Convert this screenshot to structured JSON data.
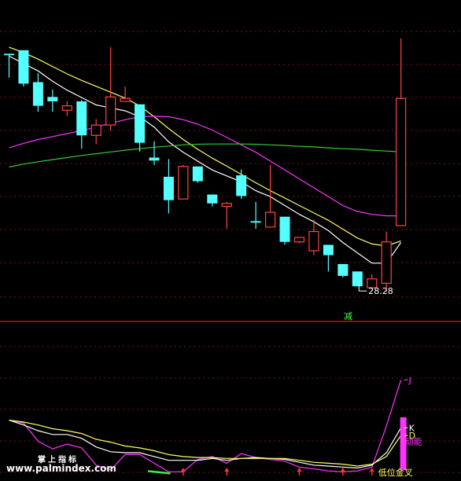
{
  "chart_data": [
    {
      "type": "candlestick",
      "panel": "main",
      "ylim": [
        27.4,
        36.7
      ],
      "candles": [
        {
          "o": 35.63,
          "h": 35.68,
          "l": 34.87,
          "c": 35.68,
          "color": "cyan"
        },
        {
          "o": 35.8,
          "h": 35.8,
          "l": 34.57,
          "c": 34.67,
          "color": "cyan"
        },
        {
          "o": 34.72,
          "h": 35.02,
          "l": 33.72,
          "c": 33.92,
          "color": "cyan"
        },
        {
          "o": 34.22,
          "h": 34.47,
          "l": 33.72,
          "c": 34.07,
          "color": "cyan"
        },
        {
          "o": 33.77,
          "h": 34.07,
          "l": 33.57,
          "c": 33.92,
          "color": "red"
        },
        {
          "o": 34.07,
          "h": 34.12,
          "l": 32.47,
          "c": 32.92,
          "color": "cyan"
        },
        {
          "o": 32.92,
          "h": 33.47,
          "l": 32.62,
          "c": 33.27,
          "color": "red"
        },
        {
          "o": 33.27,
          "h": 35.9,
          "l": 33.07,
          "c": 34.22,
          "color": "red"
        },
        {
          "o": 34.07,
          "h": 34.57,
          "l": 34.07,
          "c": 34.17,
          "color": "red"
        },
        {
          "o": 33.97,
          "h": 33.97,
          "l": 32.37,
          "c": 32.67,
          "color": "cyan"
        },
        {
          "o": 32.17,
          "h": 32.72,
          "l": 31.92,
          "c": 32.07,
          "color": "cyan"
        },
        {
          "o": 31.52,
          "h": 32.12,
          "l": 30.28,
          "c": 30.73,
          "color": "cyan"
        },
        {
          "o": 30.77,
          "h": 31.92,
          "l": 30.77,
          "c": 31.87,
          "color": "red"
        },
        {
          "o": 31.87,
          "h": 31.87,
          "l": 31.32,
          "c": 31.37,
          "color": "cyan"
        },
        {
          "o": 30.92,
          "h": 30.92,
          "l": 30.52,
          "c": 30.62,
          "color": "cyan"
        },
        {
          "o": 30.62,
          "h": 30.67,
          "l": 29.77,
          "c": 30.52,
          "color": "red"
        },
        {
          "o": 31.57,
          "h": 31.77,
          "l": 30.77,
          "c": 30.87,
          "color": "cyan"
        },
        {
          "o": 30.02,
          "h": 30.67,
          "l": 29.77,
          "c": 29.97,
          "color": "cyan"
        },
        {
          "o": 29.82,
          "h": 31.92,
          "l": 29.82,
          "c": 30.32,
          "color": "red"
        },
        {
          "o": 30.17,
          "h": 30.17,
          "l": 29.22,
          "c": 29.32,
          "color": "cyan"
        },
        {
          "o": 29.32,
          "h": 29.47,
          "l": 29.27,
          "c": 29.47,
          "color": "red"
        },
        {
          "o": 29.67,
          "h": 30.07,
          "l": 28.87,
          "c": 29.02,
          "color": "red"
        },
        {
          "o": 29.22,
          "h": 29.22,
          "l": 28.32,
          "c": 28.87,
          "color": "cyan"
        },
        {
          "o": 28.57,
          "h": 28.57,
          "l": 28.12,
          "c": 28.17,
          "color": "cyan"
        },
        {
          "o": 28.32,
          "h": 28.32,
          "l": 27.82,
          "c": 27.82,
          "color": "cyan"
        },
        {
          "o": 27.77,
          "h": 28.22,
          "l": 27.67,
          "c": 28.07,
          "color": "red"
        },
        {
          "o": 27.92,
          "h": 29.67,
          "l": 27.62,
          "c": 29.32,
          "color": "red"
        },
        {
          "o": 29.87,
          "h": 36.2,
          "l": 29.87,
          "c": 34.17,
          "color": "red"
        }
      ],
      "series": [
        {
          "color": "#ffffff",
          "values": [
            35.6,
            35.35,
            35.1,
            34.75,
            34.45,
            34.2,
            33.95,
            33.85,
            33.75,
            33.55,
            33.2,
            32.7,
            32.35,
            32.05,
            31.75,
            31.55,
            31.35,
            31.05,
            30.85,
            30.55,
            30.25,
            30.0,
            29.7,
            29.3,
            28.95,
            28.6,
            28.6,
            29.3
          ]
        },
        {
          "color": "#ffff66",
          "values": [
            35.9,
            35.72,
            35.5,
            35.25,
            35.0,
            34.78,
            34.58,
            34.38,
            34.18,
            33.92,
            33.55,
            33.15,
            32.78,
            32.45,
            32.15,
            31.88,
            31.6,
            31.32,
            31.05,
            30.8,
            30.55,
            30.3,
            30.05,
            29.75,
            29.45,
            29.25,
            29.18,
            29.35
          ]
        },
        {
          "color": "#ff33ff",
          "values": [
            32.5,
            32.65,
            32.78,
            32.88,
            32.98,
            33.08,
            33.2,
            33.33,
            33.45,
            33.55,
            33.57,
            33.55,
            33.45,
            33.3,
            33.1,
            32.85,
            32.6,
            32.35,
            32.05,
            31.75,
            31.45,
            31.15,
            30.85,
            30.55,
            30.35,
            30.25,
            30.2,
            30.2
          ]
        },
        {
          "color": "#33cc33",
          "values": [
            31.85,
            31.95,
            32.03,
            32.1,
            32.17,
            32.24,
            32.3,
            32.36,
            32.42,
            32.47,
            32.52,
            32.56,
            32.6,
            32.62,
            32.63,
            32.63,
            32.63,
            32.62,
            32.6,
            32.58,
            32.55,
            32.53,
            32.5,
            32.47,
            32.45,
            32.42,
            32.39,
            32.36
          ]
        }
      ],
      "annotation": {
        "label": "28.28",
        "index": 24
      }
    },
    {
      "type": "line",
      "panel": "indicator",
      "ylim": [
        -5,
        105
      ],
      "series": [
        {
          "name": "J",
          "color": "#ff33ff",
          "values": [
            52,
            49,
            30,
            22,
            27,
            23,
            5,
            0,
            16,
            16,
            7,
            -2,
            -2,
            11,
            14,
            7,
            17,
            13,
            11,
            9,
            3,
            1,
            -1,
            -2,
            -1,
            3,
            46,
            94
          ]
        },
        {
          "name": "K",
          "color": "#ffffff",
          "values": [
            52,
            47,
            41,
            37,
            37,
            33,
            24,
            19,
            18,
            18,
            14,
            10,
            10,
            10,
            12,
            10,
            12,
            13,
            12,
            11,
            8,
            5,
            4,
            3,
            2,
            5,
            18,
            44
          ]
        },
        {
          "name": "D",
          "color": "#ffff66",
          "values": [
            52,
            50,
            47,
            43,
            41,
            38,
            32,
            29,
            25,
            23,
            20,
            16,
            14,
            13,
            13,
            12,
            12,
            12,
            12,
            12,
            10,
            8,
            7,
            6,
            4,
            6,
            14,
            36
          ]
        }
      ],
      "bars": [
        {
          "index": 27,
          "from": 0,
          "to": 55,
          "color": "#ff33ff"
        }
      ],
      "up_arrows": [
        12,
        15,
        20,
        23,
        25
      ],
      "labels": [
        "J",
        "K",
        "D",
        "动能"
      ],
      "signal_label": "低位金叉"
    }
  ],
  "divider_label": "减",
  "watermark": {
    "cn": "掌上指标",
    "url": "www.palmindex.com"
  }
}
